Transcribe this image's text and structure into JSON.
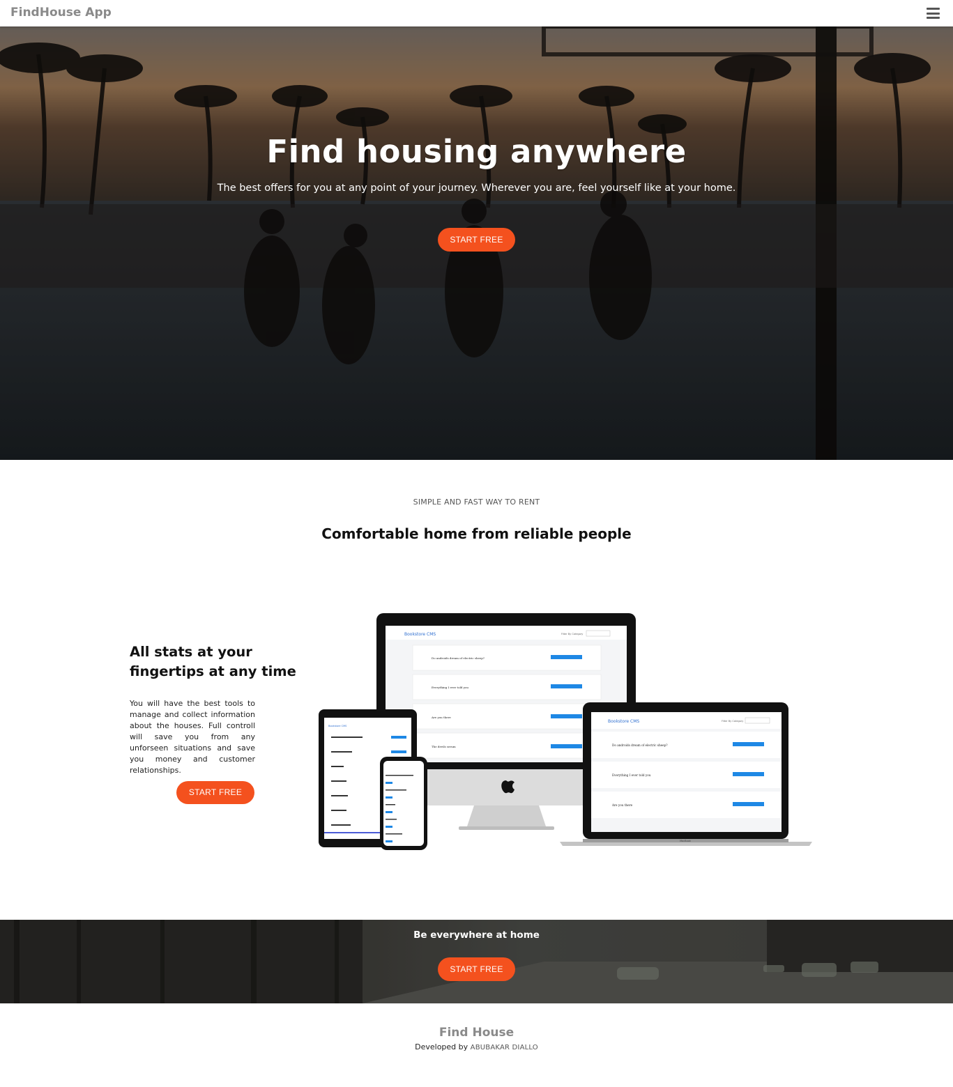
{
  "navbar": {
    "brand": "FindHouse App",
    "menu_icon": "hamburger-menu-icon"
  },
  "hero": {
    "title": "Find housing anywhere",
    "subtitle": "The best offers for you at any point of your journey. Wherever you are, feel yourself like at your home.",
    "cta": "START FREE"
  },
  "intro": {
    "kicker": "SIMPLE AND FAST WAY TO RENT",
    "title": "Comfortable home from reliable people"
  },
  "feature": {
    "title": "All stats at your fingertips at any time",
    "text": "You will have the best tools to manage and collect information about the houses. Full controll will save you from any unforseen situations and save you money and customer relationships.",
    "cta": "START FREE",
    "screen": {
      "app_title": "Bookstore CMS",
      "filter_label": "Filter By Category",
      "books": [
        "Do androids dream of electric sheep?",
        "Everything I ever told you",
        "Are you there",
        "The devils serum"
      ],
      "laptop_label": "MacBook"
    }
  },
  "band": {
    "title": "Be everywhere at home",
    "cta": "START FREE"
  },
  "footer": {
    "title": "Find House",
    "credit_prefix": "Developed by",
    "author": "ABUBAKAR DIALLO"
  },
  "colors": {
    "accent": "#f4511e",
    "brand_grey": "#8a8a8a",
    "screen_button": "#1e88e5",
    "screen_title": "#2f6fd0"
  }
}
